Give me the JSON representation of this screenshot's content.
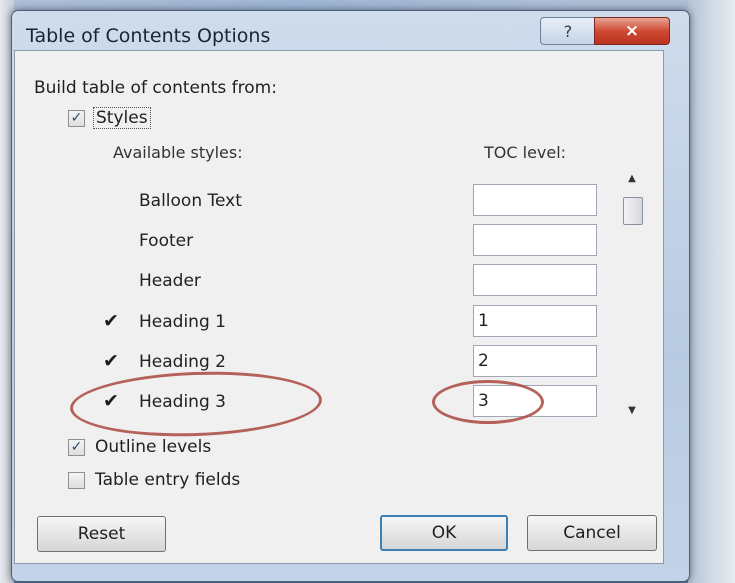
{
  "window": {
    "title": "Table of Contents Options",
    "help_label": "?",
    "close_label": "×"
  },
  "build_from_label": "Build table of contents from:",
  "styles_checkbox": {
    "label": "Styles",
    "checked": true
  },
  "available_styles_header": "Available styles:",
  "toc_level_header": "TOC level:",
  "styles": [
    {
      "name": "Balloon Text",
      "checked": false,
      "level": ""
    },
    {
      "name": "Footer",
      "checked": false,
      "level": ""
    },
    {
      "name": "Header",
      "checked": false,
      "level": ""
    },
    {
      "name": "Heading 1",
      "checked": true,
      "level": "1"
    },
    {
      "name": "Heading 2",
      "checked": true,
      "level": "2"
    },
    {
      "name": "Heading 3",
      "checked": true,
      "level": "3"
    }
  ],
  "check_mark": "✔",
  "outline_levels": {
    "label": "Outline levels",
    "checked": true
  },
  "table_entry_fields": {
    "label": "Table entry fields",
    "checked": false
  },
  "buttons": {
    "reset": "Reset",
    "ok": "OK",
    "cancel": "Cancel"
  },
  "colors": {
    "annotation": "#a8483e",
    "close": "#cf4a33"
  }
}
